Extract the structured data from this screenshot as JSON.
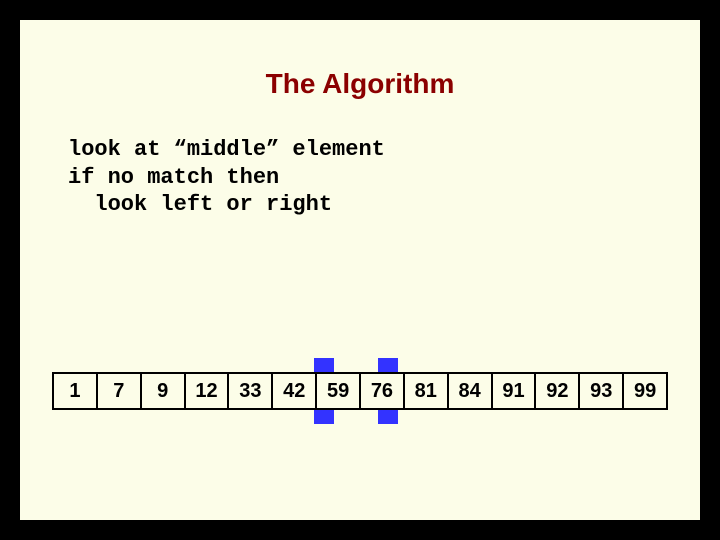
{
  "title": "The Algorithm",
  "pseudocode": "look at “middle” element\nif no match then\n  look left or right",
  "array": [
    "1",
    "7",
    "9",
    "12",
    "33",
    "42",
    "59",
    "76",
    "81",
    "84",
    "91",
    "92",
    "93",
    "99"
  ],
  "highlight_between_indices": [
    5,
    6,
    7
  ],
  "colors": {
    "bg": "#fcfde8",
    "title": "#8b0000",
    "highlight": "#3333ff"
  }
}
